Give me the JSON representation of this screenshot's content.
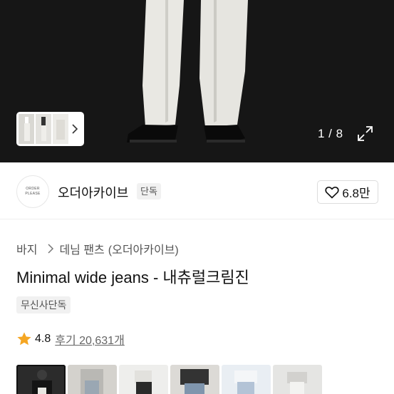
{
  "gallery": {
    "counter": "1 / 8",
    "current_index": 1,
    "total": 8
  },
  "brand": {
    "name": "오더아카이브",
    "badge": "단독",
    "logo_text_top": "ORDER",
    "logo_text_bottom": "PLEASE",
    "like_icon": "heart-icon",
    "like_count": "6.8만"
  },
  "product": {
    "breadcrumb": [
      "바지",
      "데님 팬츠",
      "(오더아카이브)"
    ],
    "title": "Minimal wide jeans - 내츄럴크림진",
    "exclusive_badge": "무신사단독"
  },
  "rating": {
    "icon": "star-icon",
    "value": "4.8",
    "review_text": "후기 20,631개"
  },
  "colors": {
    "star": "#f5a623",
    "hero_bg": "#161616",
    "badge_bg": "#f1f1f1"
  }
}
